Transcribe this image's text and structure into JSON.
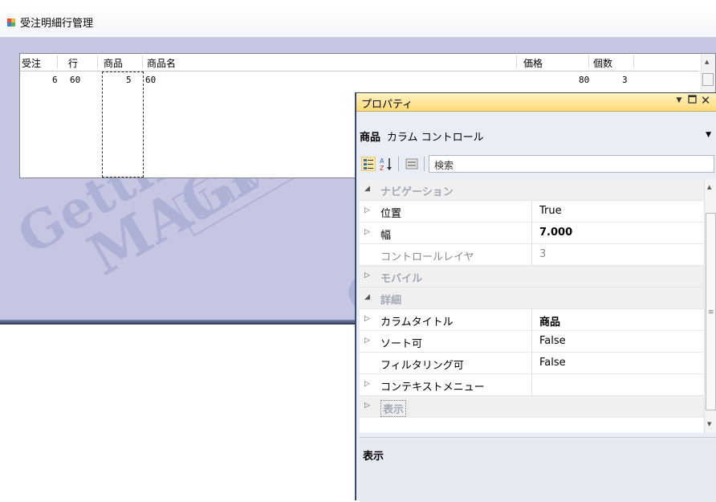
{
  "form": {
    "title": "受注明細行管理",
    "watermark": [
      "Getting",
      "MAGIC",
      "University"
    ],
    "grid": {
      "columns": [
        "受注",
        "行",
        "商品",
        "商品名",
        "価格",
        "個数"
      ],
      "row": {
        "order": "6",
        "line": "60",
        "product": "5",
        "product_name": "60",
        "price": "80",
        "qty": "3"
      }
    }
  },
  "properties": {
    "title": "プロパティ",
    "selector": {
      "name": "商品",
      "type": "カラム コントロール"
    },
    "search_placeholder": "検索",
    "rows": [
      {
        "kind": "cat",
        "toggle": "◢",
        "name": "ナビゲーション",
        "value": ""
      },
      {
        "kind": "prop",
        "toggle": "▷",
        "name": "位置",
        "value": "True"
      },
      {
        "kind": "prop",
        "toggle": "▷",
        "name": "幅",
        "value": "7.000",
        "bold": true
      },
      {
        "kind": "prop",
        "toggle": "",
        "name": "コントロールレイヤ",
        "value": "3",
        "gray": true
      },
      {
        "kind": "cat",
        "toggle": "▷",
        "name": "モバイル",
        "value": ""
      },
      {
        "kind": "cat",
        "toggle": "◢",
        "name": "詳細",
        "value": ""
      },
      {
        "kind": "prop",
        "toggle": "▷",
        "name": "カラムタイトル",
        "value": "商品",
        "bold": true
      },
      {
        "kind": "prop",
        "toggle": "▷",
        "name": "ソート可",
        "value": "False"
      },
      {
        "kind": "prop",
        "toggle": "",
        "name": "フィルタリング可",
        "value": "False"
      },
      {
        "kind": "prop",
        "toggle": "▷",
        "name": "コンテキストメニュー",
        "value": ""
      },
      {
        "kind": "cat",
        "toggle": "▷",
        "name": "表示",
        "value": ""
      }
    ],
    "description_title": "表示"
  },
  "colors": {
    "accent": "#ffd97a",
    "watermark": "#aeb1d6",
    "form_bg": "#c4c6e2"
  },
  "icons": [
    "form-icon",
    "categorized-icon",
    "alphabetical-icon",
    "property-pages-icon",
    "dropdown-icon",
    "pin-icon",
    "maximize-icon",
    "close-icon"
  ]
}
